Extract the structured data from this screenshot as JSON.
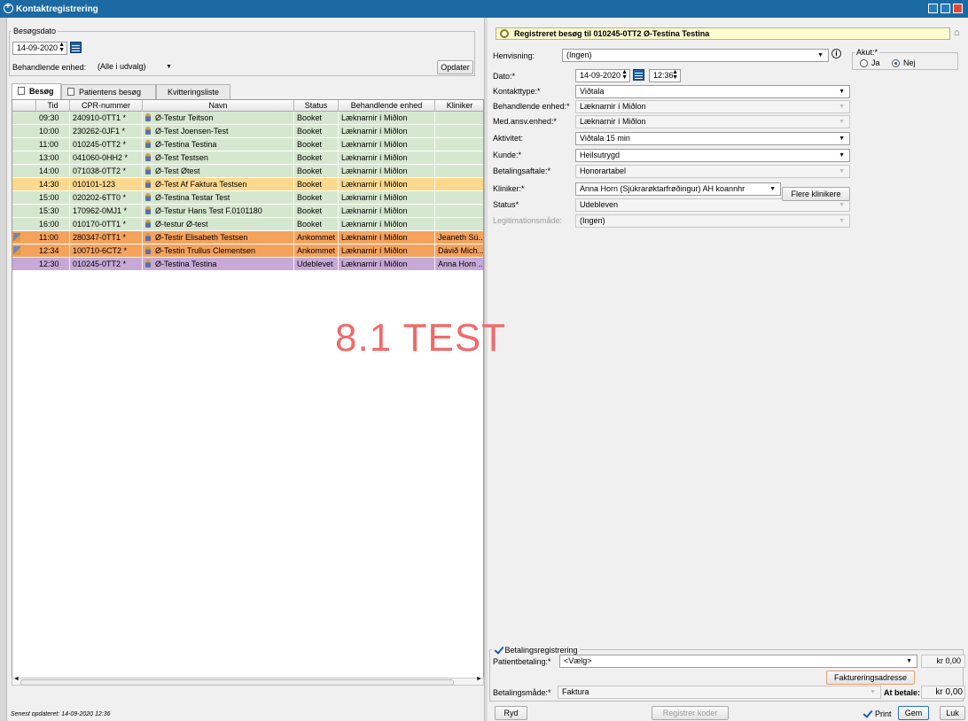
{
  "window": {
    "title": "Kontaktregistrering"
  },
  "left": {
    "besogsdato_legend": "Besøgsdato",
    "date": "14-09-2020",
    "enhed_label": "Behandlende enhed:",
    "enhed_value": "(Alle i udvalg)",
    "update_button": "Opdater",
    "tabs": [
      "Besøg",
      "Patientens besøg",
      "Kvitteringsliste"
    ],
    "columns": [
      "Tid",
      "CPR-nummer",
      "Navn",
      "Status",
      "Behandlende enhed",
      "Kliniker"
    ],
    "rows": [
      {
        "tid": "09:30",
        "cpr": "240910-0TT1 *",
        "navn": "Ø-Testur Teitson",
        "status": "Booket",
        "enhed": "Læknarnir í Miðlon",
        "kliniker": ""
      },
      {
        "tid": "10:00",
        "cpr": "230262-0JF1 *",
        "navn": "Ø-Test Joensen-Test",
        "status": "Booket",
        "enhed": "Læknarnir í Miðlon",
        "kliniker": ""
      },
      {
        "tid": "11:00",
        "cpr": "010245-0TT2 *",
        "navn": "Ø-Testina Testina",
        "status": "Booket",
        "enhed": "Læknarnir í Miðlon",
        "kliniker": ""
      },
      {
        "tid": "13:00",
        "cpr": "041060-0HH2 *",
        "navn": "Ø-Test Testsen",
        "status": "Booket",
        "enhed": "Læknarnir í Miðlon",
        "kliniker": ""
      },
      {
        "tid": "14:00",
        "cpr": "071038-0TT2 *",
        "navn": "Ø-Test Øtest",
        "status": "Booket",
        "enhed": "Læknarnir í Miðlon",
        "kliniker": ""
      },
      {
        "tid": "14:30",
        "cpr": "010101-123",
        "navn": "Ø-Test Af Faktura Testsen",
        "status": "Booket",
        "enhed": "Læknarnir í Miðlon",
        "kliniker": ""
      },
      {
        "tid": "15:00",
        "cpr": "020202-6TT0 *",
        "navn": "Ø-Testina Testar Test",
        "status": "Booket",
        "enhed": "Læknarnir í Miðlon",
        "kliniker": ""
      },
      {
        "tid": "15:30",
        "cpr": "170962-0MJ1 *",
        "navn": "Ø-Testur Hans Test F.0101180",
        "status": "Booket",
        "enhed": "Læknarnir í Miðlon",
        "kliniker": ""
      },
      {
        "tid": "16:00",
        "cpr": "010170-0TT1 *",
        "navn": "Ø-testur Ø-test",
        "status": "Booket",
        "enhed": "Læknarnir í Miðlon",
        "kliniker": ""
      },
      {
        "tid": "11:00",
        "cpr": "280347-0TT1 *",
        "navn": "Ø-Testir Elisabeth Testsen",
        "status": "Ankommet",
        "enhed": "Læknarnir í Miðlon",
        "kliniker": "Jeaneth Sú..."
      },
      {
        "tid": "12:34",
        "cpr": "100710-6CT2 *",
        "navn": "Ø-Testin Trullus Clementsen",
        "status": "Ankommet",
        "enhed": "Læknarnir í Miðlon",
        "kliniker": "Dávið Mich..."
      },
      {
        "tid": "12:30",
        "cpr": "010245-0TT2 *",
        "navn": "Ø-Testina Testina",
        "status": "Udeblevet",
        "enhed": "Læknarnir í Miðlon",
        "kliniker": "Anna Horn ..."
      }
    ],
    "footer": "Senest opdateret: 14-09-2020 12:36"
  },
  "colors": {
    "row_booked": "#d6e7cf",
    "row_selected": "#fdd98d",
    "row_arrived": "#f5a25d",
    "row_absent": "#c7a9d8"
  },
  "watermark": "8.1 TEST",
  "right": {
    "header": "Registreret besøg til 010245-0TT2 Ø-Testina Testina",
    "henvisning_label": "Henvisning:",
    "henvisning_value": "(Ingen)",
    "dato_label": "Dato:*",
    "dato_value": "14-09-2020",
    "time_value": "12:36",
    "akut_legend": "Akut:*",
    "akut_ja": "Ja",
    "akut_nej": "Nej",
    "fields": [
      {
        "label": "Kontakttype:*",
        "value": "Viðtala",
        "disabled": false
      },
      {
        "label": "Behandlende enhed:*",
        "value": "Læknarnir í Miðlon",
        "disabled": true
      },
      {
        "label": "Med.ansv.enhed:*",
        "value": "Læknarnir í Miðlon",
        "disabled": true
      },
      {
        "label": "Aktivitet:",
        "value": "Viðtala 15 min",
        "disabled": false
      },
      {
        "label": "Kunde:*",
        "value": "Heilsutrygd",
        "disabled": false
      },
      {
        "label": "Betalingsaftale:*",
        "value": "Honorartabel",
        "disabled": true
      },
      {
        "label": "Kliniker:*",
        "value": "Anna Horn (Sjúkrarøktarfrøðingur) AH koannhr",
        "disabled": false
      },
      {
        "label": "Status*",
        "value": "Udebleven",
        "disabled": true
      },
      {
        "label": "Legitimationsmåde:",
        "value": "(Ingen)",
        "disabled": true
      }
    ],
    "flere_button": "Flere klinikere",
    "payment": {
      "legend": "Betalingsregistrering",
      "patient_label": "Patientbetaling:*",
      "patient_value": "<Vælg>",
      "patient_amount": "kr 0,00",
      "invoice_button": "Faktureringsadresse",
      "method_label": "Betalingsmåde:*",
      "method_value": "Faktura",
      "at_betale_label": "At betale:",
      "at_betale_value": "kr 0,00"
    },
    "bottom": {
      "ryd": "Ryd",
      "registrer": "Registrer koder",
      "print": "Print",
      "gem": "Gem",
      "luk": "Luk"
    }
  }
}
